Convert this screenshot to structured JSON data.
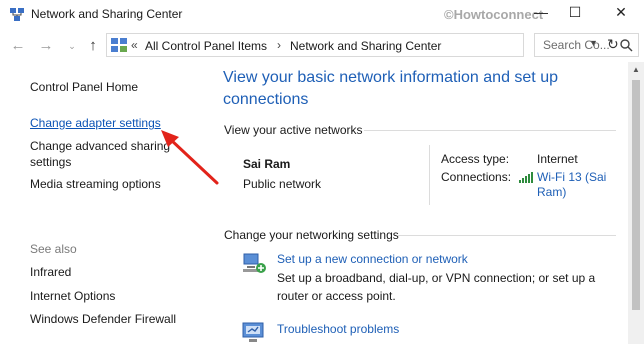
{
  "window": {
    "title": "Network and Sharing Center",
    "watermark": "©Howtoconnect",
    "controls": {
      "minimize": "—",
      "maximize": "☐",
      "close": "✕"
    }
  },
  "nav": {
    "back_icon": "back-arrow-icon",
    "forward_icon": "forward-arrow-icon",
    "recent_icon": "chevron-down-icon",
    "up_icon": "up-arrow-icon",
    "breadcrumb": {
      "overflow": "«",
      "items": [
        "All Control Panel Items",
        "Network and Sharing Center"
      ],
      "separator": "›"
    },
    "refresh_icon": "refresh-icon",
    "search_placeholder": "Search Co..."
  },
  "sidebar": {
    "home": "Control Panel Home",
    "links": [
      "Change adapter settings",
      "Change advanced sharing settings",
      "Media streaming options"
    ],
    "see_also_label": "See also",
    "see_also": [
      "Infrared",
      "Internet Options",
      "Windows Defender Firewall"
    ]
  },
  "main": {
    "title": "View your basic network information and set up connections",
    "active_networks_heading": "View your active networks",
    "network": {
      "name": "Sai Ram",
      "type": "Public network",
      "access_type_label": "Access type:",
      "access_type_value": "Internet",
      "connections_label": "Connections:",
      "connections_value": "Wi-Fi 13 (Sai Ram)"
    },
    "settings_heading": "Change your networking settings",
    "tasks": [
      {
        "title": "Set up a new connection or network",
        "description": "Set up a broadband, dial-up, or VPN connection; or set up a router or access point."
      },
      {
        "title": "Troubleshoot problems",
        "description": ""
      }
    ]
  },
  "colors": {
    "link": "#1e5fb6",
    "sidebar_link_highlight": "#0b53b5",
    "annotation_arrow": "#e2231a"
  }
}
